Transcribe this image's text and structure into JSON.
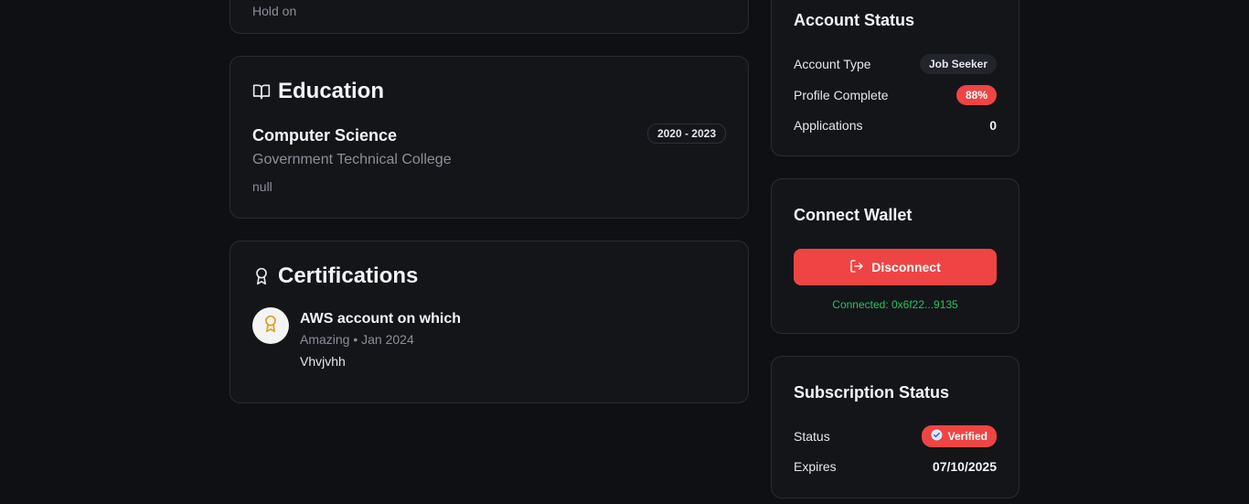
{
  "previous_card": {
    "text": "Hold on"
  },
  "education": {
    "title": "Education",
    "icon": "book-open-icon",
    "entry": {
      "degree": "Computer Science",
      "school": "Government Technical College",
      "description": "null",
      "years": "2020 - 2023"
    }
  },
  "certifications": {
    "title": "Certifications",
    "icon": "award-icon",
    "entry": {
      "name": "AWS account on which",
      "meta": "Amazing • Jan 2024",
      "description": "Vhvjvhh"
    }
  },
  "account_status": {
    "title": "Account Status",
    "rows": [
      {
        "label": "Account Type",
        "value": "Job Seeker"
      },
      {
        "label": "Profile Complete",
        "value": "88%"
      },
      {
        "label": "Applications",
        "value": "0"
      }
    ]
  },
  "wallet": {
    "title": "Connect Wallet",
    "button_label": "Disconnect",
    "connected_text": "Connected: 0x6f22...9135"
  },
  "subscription": {
    "title": "Subscription Status",
    "status_label": "Status",
    "status_value": "Verified",
    "expires_label": "Expires",
    "expires_value": "07/10/2025"
  },
  "colors": {
    "background": "#0f1014",
    "card": "#141519",
    "accent_red": "#ef4444",
    "success_green": "#22c55e",
    "cert_icon_gold": "#d9a21b"
  }
}
